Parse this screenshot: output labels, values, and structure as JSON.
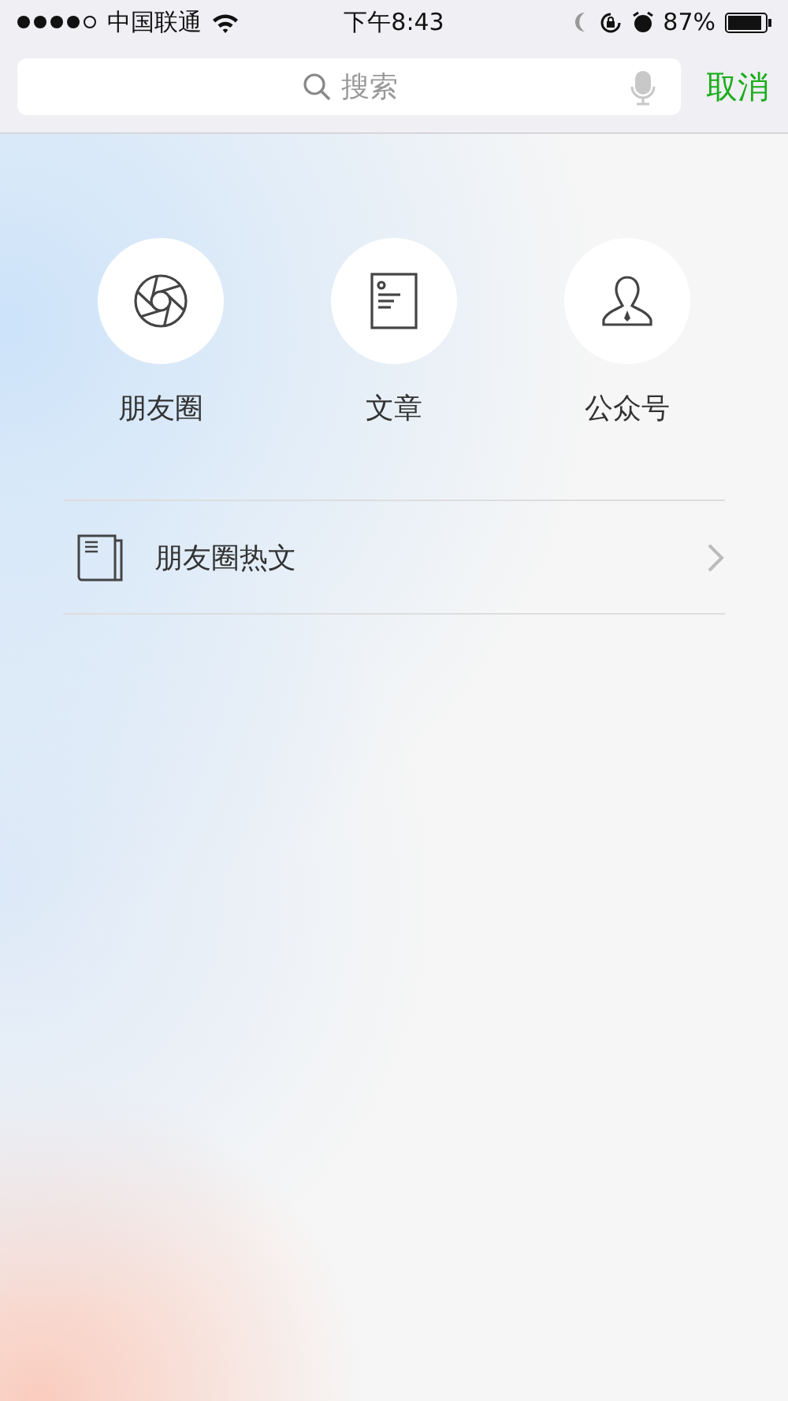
{
  "status_bar": {
    "carrier": "中国联通",
    "time": "下午8:43",
    "battery": "87%"
  },
  "search": {
    "placeholder": "搜索",
    "cancel": "取消"
  },
  "categories": [
    {
      "kind": "moments",
      "label": "朋友圈"
    },
    {
      "kind": "article",
      "label": "文章"
    },
    {
      "kind": "account",
      "label": "公众号"
    }
  ],
  "list": [
    {
      "label": "朋友圈热文"
    }
  ]
}
